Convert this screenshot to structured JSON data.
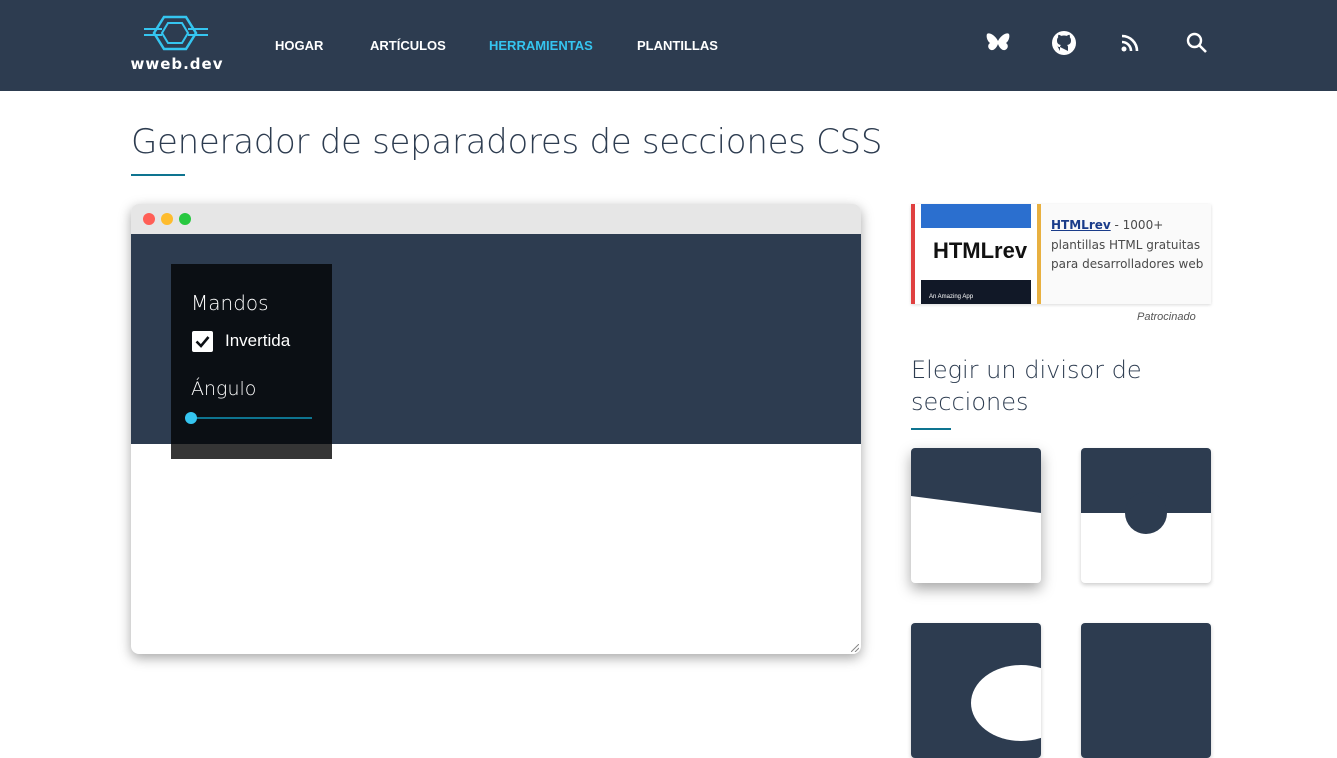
{
  "brand": {
    "name": "wweb.dev"
  },
  "nav": {
    "items": [
      "HOGAR",
      "ARTÍCULOS",
      "HERRAMIENTAS",
      "PLANTILLAS"
    ],
    "active": "HERRAMIENTAS"
  },
  "header_icons": [
    "butterfly-icon",
    "github-icon",
    "rss-icon",
    "search-icon"
  ],
  "page": {
    "title": "Generador de separadores de secciones CSS"
  },
  "controls": {
    "title": "Mandos",
    "inverted_label": "Invertida",
    "inverted_checked": true,
    "angle_label": "Ángulo",
    "angle_value": 0
  },
  "sponsor": {
    "image_text": "HTMLrev",
    "image_caption": "An Amazing App",
    "link": "HTMLrev",
    "description": " - 1000+ plantillas HTML gratuitas para desarrolladores web",
    "label": "Patrocinado"
  },
  "picker": {
    "title": "Elegir un divisor de secciones"
  },
  "colors": {
    "header_bg": "#2d3c50",
    "accent": "#35c5f0",
    "rule": "#0e7490"
  }
}
